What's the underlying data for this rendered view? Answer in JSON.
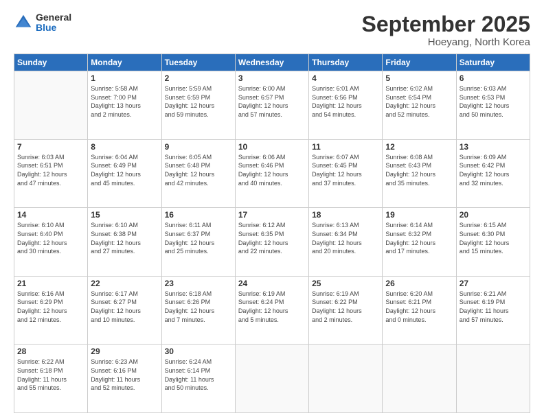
{
  "logo": {
    "general": "General",
    "blue": "Blue"
  },
  "header": {
    "month": "September 2025",
    "location": "Hoeyang, North Korea"
  },
  "weekdays": [
    "Sunday",
    "Monday",
    "Tuesday",
    "Wednesday",
    "Thursday",
    "Friday",
    "Saturday"
  ],
  "weeks": [
    [
      {
        "day": "",
        "info": ""
      },
      {
        "day": "1",
        "info": "Sunrise: 5:58 AM\nSunset: 7:00 PM\nDaylight: 13 hours\nand 2 minutes."
      },
      {
        "day": "2",
        "info": "Sunrise: 5:59 AM\nSunset: 6:59 PM\nDaylight: 12 hours\nand 59 minutes."
      },
      {
        "day": "3",
        "info": "Sunrise: 6:00 AM\nSunset: 6:57 PM\nDaylight: 12 hours\nand 57 minutes."
      },
      {
        "day": "4",
        "info": "Sunrise: 6:01 AM\nSunset: 6:56 PM\nDaylight: 12 hours\nand 54 minutes."
      },
      {
        "day": "5",
        "info": "Sunrise: 6:02 AM\nSunset: 6:54 PM\nDaylight: 12 hours\nand 52 minutes."
      },
      {
        "day": "6",
        "info": "Sunrise: 6:03 AM\nSunset: 6:53 PM\nDaylight: 12 hours\nand 50 minutes."
      }
    ],
    [
      {
        "day": "7",
        "info": "Sunrise: 6:03 AM\nSunset: 6:51 PM\nDaylight: 12 hours\nand 47 minutes."
      },
      {
        "day": "8",
        "info": "Sunrise: 6:04 AM\nSunset: 6:49 PM\nDaylight: 12 hours\nand 45 minutes."
      },
      {
        "day": "9",
        "info": "Sunrise: 6:05 AM\nSunset: 6:48 PM\nDaylight: 12 hours\nand 42 minutes."
      },
      {
        "day": "10",
        "info": "Sunrise: 6:06 AM\nSunset: 6:46 PM\nDaylight: 12 hours\nand 40 minutes."
      },
      {
        "day": "11",
        "info": "Sunrise: 6:07 AM\nSunset: 6:45 PM\nDaylight: 12 hours\nand 37 minutes."
      },
      {
        "day": "12",
        "info": "Sunrise: 6:08 AM\nSunset: 6:43 PM\nDaylight: 12 hours\nand 35 minutes."
      },
      {
        "day": "13",
        "info": "Sunrise: 6:09 AM\nSunset: 6:42 PM\nDaylight: 12 hours\nand 32 minutes."
      }
    ],
    [
      {
        "day": "14",
        "info": "Sunrise: 6:10 AM\nSunset: 6:40 PM\nDaylight: 12 hours\nand 30 minutes."
      },
      {
        "day": "15",
        "info": "Sunrise: 6:10 AM\nSunset: 6:38 PM\nDaylight: 12 hours\nand 27 minutes."
      },
      {
        "day": "16",
        "info": "Sunrise: 6:11 AM\nSunset: 6:37 PM\nDaylight: 12 hours\nand 25 minutes."
      },
      {
        "day": "17",
        "info": "Sunrise: 6:12 AM\nSunset: 6:35 PM\nDaylight: 12 hours\nand 22 minutes."
      },
      {
        "day": "18",
        "info": "Sunrise: 6:13 AM\nSunset: 6:34 PM\nDaylight: 12 hours\nand 20 minutes."
      },
      {
        "day": "19",
        "info": "Sunrise: 6:14 AM\nSunset: 6:32 PM\nDaylight: 12 hours\nand 17 minutes."
      },
      {
        "day": "20",
        "info": "Sunrise: 6:15 AM\nSunset: 6:30 PM\nDaylight: 12 hours\nand 15 minutes."
      }
    ],
    [
      {
        "day": "21",
        "info": "Sunrise: 6:16 AM\nSunset: 6:29 PM\nDaylight: 12 hours\nand 12 minutes."
      },
      {
        "day": "22",
        "info": "Sunrise: 6:17 AM\nSunset: 6:27 PM\nDaylight: 12 hours\nand 10 minutes."
      },
      {
        "day": "23",
        "info": "Sunrise: 6:18 AM\nSunset: 6:26 PM\nDaylight: 12 hours\nand 7 minutes."
      },
      {
        "day": "24",
        "info": "Sunrise: 6:19 AM\nSunset: 6:24 PM\nDaylight: 12 hours\nand 5 minutes."
      },
      {
        "day": "25",
        "info": "Sunrise: 6:19 AM\nSunset: 6:22 PM\nDaylight: 12 hours\nand 2 minutes."
      },
      {
        "day": "26",
        "info": "Sunrise: 6:20 AM\nSunset: 6:21 PM\nDaylight: 12 hours\nand 0 minutes."
      },
      {
        "day": "27",
        "info": "Sunrise: 6:21 AM\nSunset: 6:19 PM\nDaylight: 11 hours\nand 57 minutes."
      }
    ],
    [
      {
        "day": "28",
        "info": "Sunrise: 6:22 AM\nSunset: 6:18 PM\nDaylight: 11 hours\nand 55 minutes."
      },
      {
        "day": "29",
        "info": "Sunrise: 6:23 AM\nSunset: 6:16 PM\nDaylight: 11 hours\nand 52 minutes."
      },
      {
        "day": "30",
        "info": "Sunrise: 6:24 AM\nSunset: 6:14 PM\nDaylight: 11 hours\nand 50 minutes."
      },
      {
        "day": "",
        "info": ""
      },
      {
        "day": "",
        "info": ""
      },
      {
        "day": "",
        "info": ""
      },
      {
        "day": "",
        "info": ""
      }
    ]
  ]
}
